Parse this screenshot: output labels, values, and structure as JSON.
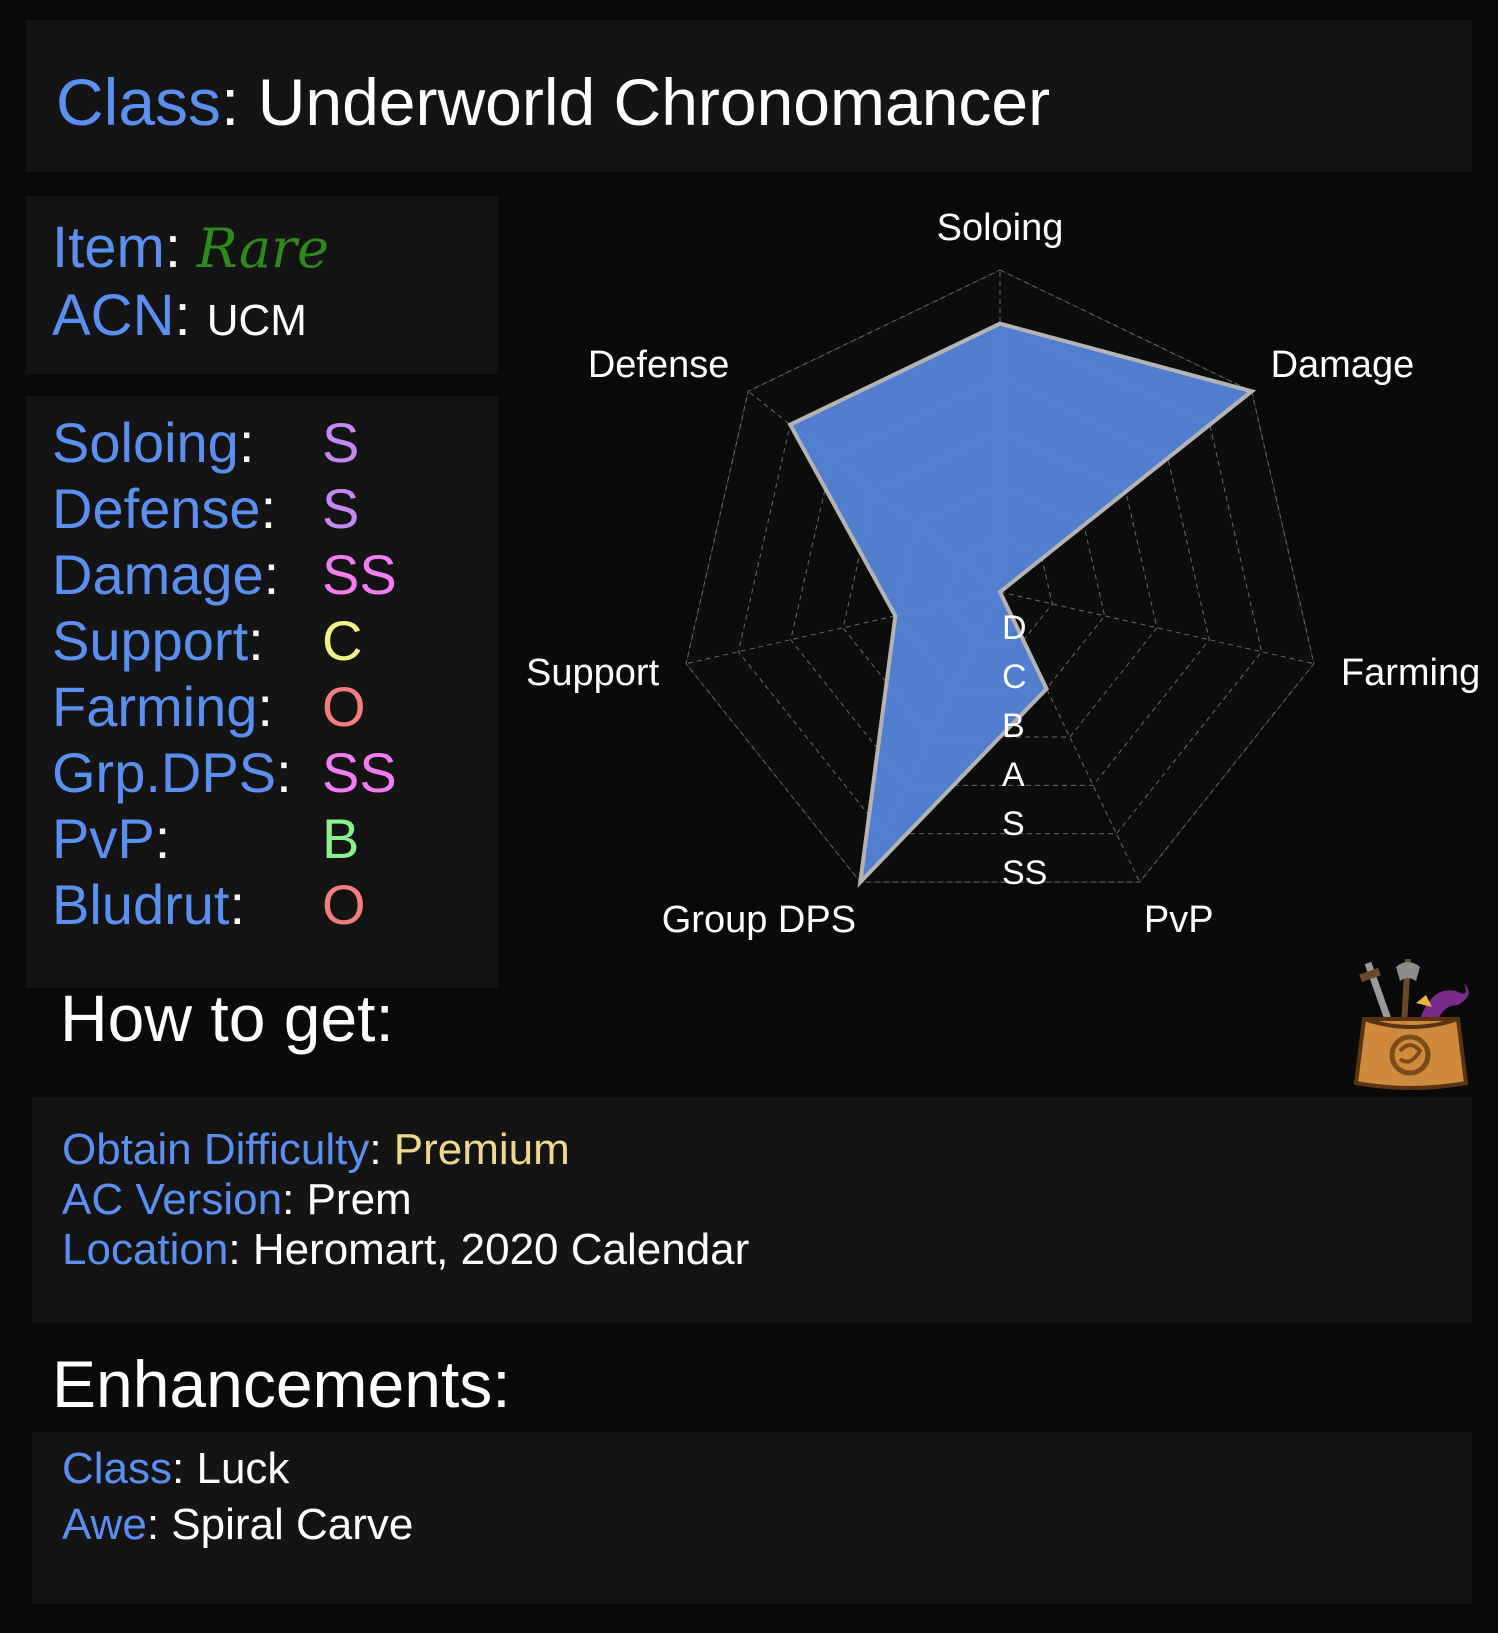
{
  "header": {
    "class_label": "Class",
    "class_name": "Underworld Chronomancer"
  },
  "item": {
    "item_label": "Item",
    "rarity": "Rare",
    "acn_label": "ACN",
    "acn": "UCM"
  },
  "colors": {
    "label": "#5b8ff0",
    "rarity": "#2f8a1c",
    "radar_fill": "#5585d9",
    "grade_S": "#c48af2",
    "grade_SS": "#f27ef2",
    "grade_C": "#f2f28a",
    "grade_O": "#f27e7e",
    "grade_B": "#8af28a",
    "premium": "#f0d890"
  },
  "grades": [
    {
      "label": "Soloing",
      "value": "S",
      "color": "#c48af2"
    },
    {
      "label": "Defense",
      "value": "S",
      "color": "#c48af2"
    },
    {
      "label": "Damage",
      "value": "SS",
      "color": "#f27ef2"
    },
    {
      "label": "Support",
      "value": "C",
      "color": "#f2f28a"
    },
    {
      "label": "Farming",
      "value": "O",
      "color": "#f27e7e"
    },
    {
      "label": "Grp.DPS",
      "value": "SS",
      "color": "#f27ef2"
    },
    {
      "label": "PvP",
      "value": "B",
      "color": "#8af28a"
    },
    {
      "label": "Bludrut",
      "value": "O",
      "color": "#f27e7e"
    }
  ],
  "chart_data": {
    "type": "radar",
    "axes": [
      "Soloing",
      "Damage",
      "Farming",
      "PvP",
      "Group DPS",
      "Support",
      "Defense"
    ],
    "scale_labels": [
      "D",
      "C",
      "B",
      "A",
      "S",
      "SS"
    ],
    "values": [
      5,
      6,
      0,
      2,
      6,
      2,
      5
    ],
    "range": [
      0,
      6
    ],
    "grid": true,
    "fill_color": "#5585d9"
  },
  "how_to_get": {
    "heading": "How to get:",
    "difficulty_label": "Obtain Difficulty",
    "difficulty": "Premium",
    "version_label": "AC Version",
    "version": "Prem",
    "location_label": "Location",
    "location": "Heromart, 2020 Calendar"
  },
  "enhancements": {
    "heading": "Enhancements:",
    "class_label": "Class",
    "class_value": "Luck",
    "awe_label": "Awe",
    "awe_value": "Spiral Carve"
  },
  "icons": {
    "bag": "heromart-bag-icon"
  }
}
